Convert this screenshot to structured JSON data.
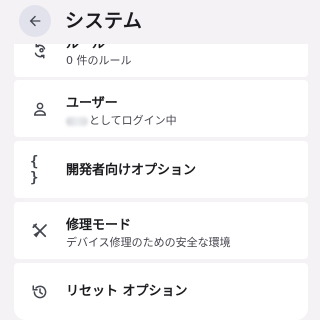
{
  "header": {
    "title": "システム"
  },
  "items": [
    {
      "title": "ルール",
      "subtitle": "0 件のルール"
    },
    {
      "title": "ユーザー",
      "subtitle": "としてログイン中"
    },
    {
      "title": "開発者向けオプション"
    },
    {
      "title": "修理モード",
      "subtitle": "デバイス修理のための安全な環境"
    },
    {
      "title": "リセット オプション"
    }
  ],
  "colors": {
    "background": "#f5f2f6",
    "card": "#ffffff",
    "icon": "#44464f",
    "back_button": "#e1e2ec"
  }
}
